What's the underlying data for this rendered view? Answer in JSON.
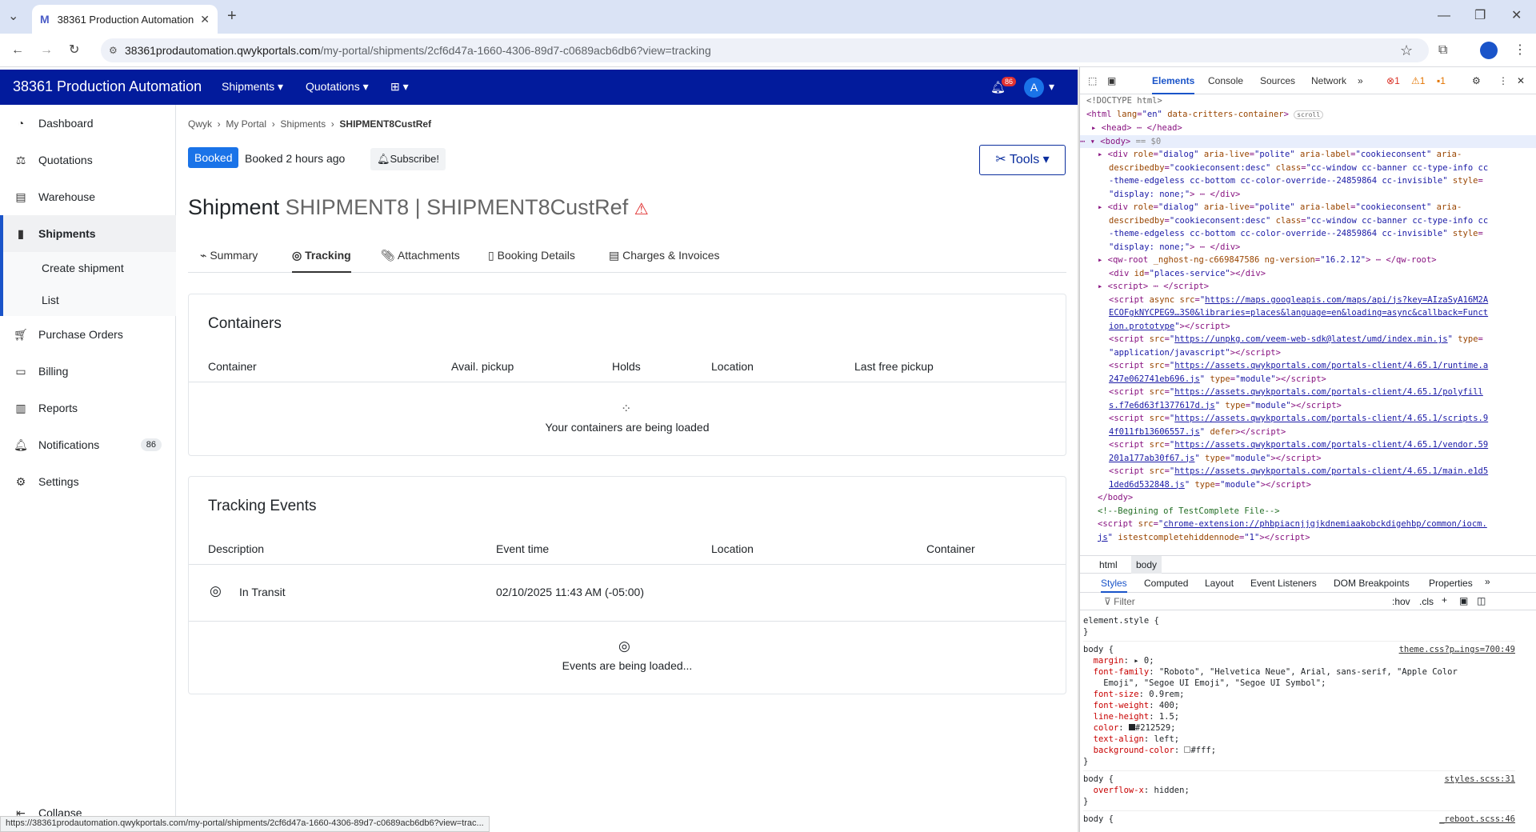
{
  "browser": {
    "tab_title": "38361 Production Automation",
    "url_host": "38361prodautomation.qwykportals.com",
    "url_path": "/my-portal/shipments/2cf6d47a-1660-4306-89d7-c0689acb6db6?view=tracking",
    "status_url": "https://38361prodautomation.qwykportals.com/my-portal/shipments/2cf6d47a-1660-4306-89d7-c0689acb6db6?view=trac..."
  },
  "header": {
    "brand": "38361 Production Automation",
    "nav": [
      "Shipments",
      "Quotations"
    ],
    "notif_count": "86",
    "avatar": "A"
  },
  "sidebar": {
    "items": [
      {
        "label": "Dashboard",
        "icon": "dashboard-icon"
      },
      {
        "label": "Quotations",
        "icon": "scale-icon"
      },
      {
        "label": "Warehouse",
        "icon": "warehouse-icon"
      },
      {
        "label": "Shipments",
        "icon": "book-icon"
      },
      {
        "label": "Purchase Orders",
        "icon": "cart-icon"
      },
      {
        "label": "Billing",
        "icon": "billing-icon"
      },
      {
        "label": "Reports",
        "icon": "chart-icon"
      },
      {
        "label": "Notifications",
        "icon": "bell-icon",
        "badge": "86"
      },
      {
        "label": "Settings",
        "icon": "gear-icon"
      }
    ],
    "sub": [
      "Create shipment",
      "List"
    ],
    "collapse": "Collapse"
  },
  "main": {
    "breadcrumb": [
      "Qwyk",
      "My Portal",
      "Shipments",
      "SHIPMENT8CustRef"
    ],
    "status": "Booked",
    "booked_time": "Booked 2 hours ago",
    "subscribe": "Subscribe!",
    "tools": "Tools",
    "title_prefix": "Shipment",
    "title_id": "SHIPMENT8 | SHIPMENT8CustRef",
    "tabs": [
      "Summary",
      "Tracking",
      "Attachments",
      "Booking Details",
      "Charges & Invoices"
    ],
    "containers": {
      "title": "Containers",
      "cols": [
        "Container",
        "Avail. pickup",
        "Holds",
        "Location",
        "Last free pickup"
      ],
      "loading": "Your containers are being loaded"
    },
    "events": {
      "title": "Tracking Events",
      "cols": [
        "Description",
        "Event time",
        "Location",
        "Container"
      ],
      "row": {
        "desc": "In Transit",
        "time": "02/10/2025 11:43 AM (-05:00)"
      },
      "loading": "Events are being loaded..."
    }
  },
  "devtools": {
    "tabs": [
      "Elements",
      "Console",
      "Sources",
      "Network"
    ],
    "errors": "1",
    "warnings": "1",
    "issues": "1",
    "crumbs": [
      "html",
      "body"
    ],
    "style_tabs": [
      "Styles",
      "Computed",
      "Layout",
      "Event Listeners",
      "DOM Breakpoints",
      "Properties"
    ],
    "filter": "Filter",
    "hov": ":hov",
    "cls": ".cls"
  }
}
